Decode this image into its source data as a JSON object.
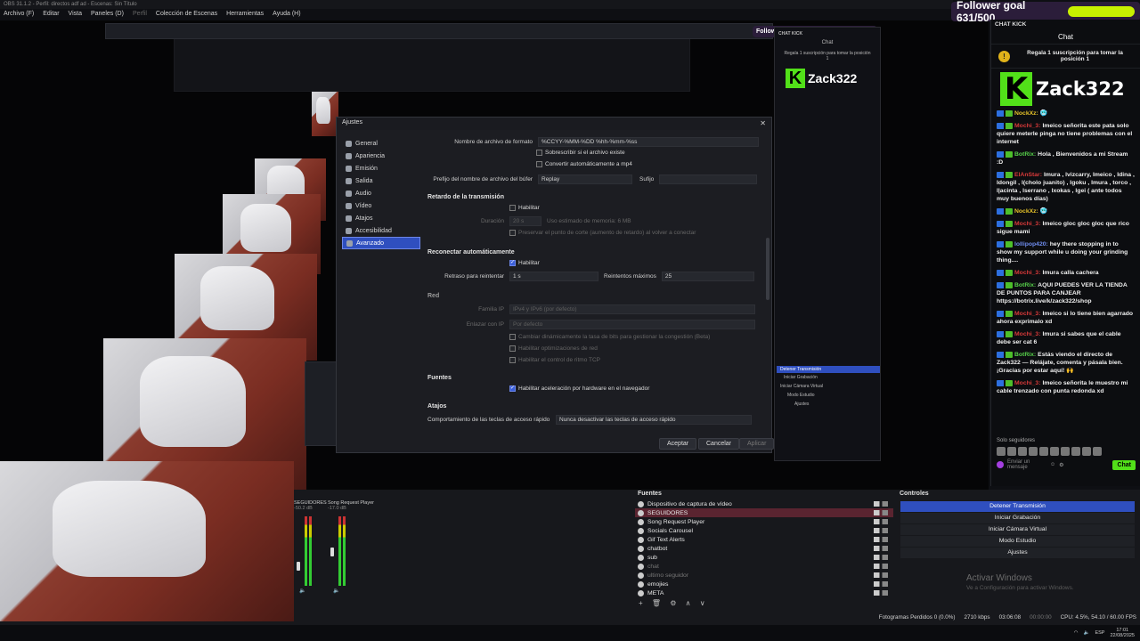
{
  "window": {
    "title": "OBS 31.1.2 - Perfil: directos adf ad - Escenas: Sin Título"
  },
  "menu": [
    "Archivo (F)",
    "Editar",
    "Vista",
    "Paneles (D)",
    "Perfil",
    "Colección de Escenas",
    "Herramientas",
    "Ayuda (H)"
  ],
  "follower_goal": {
    "label": "Follower goal 631/500",
    "progress": 1.0,
    "bar_color": "#c8f000"
  },
  "settings": {
    "title": "Ajustes",
    "nav": [
      {
        "label": "General",
        "icon": "gear-icon"
      },
      {
        "label": "Apariencia",
        "icon": "palette-icon"
      },
      {
        "label": "Emisión",
        "icon": "broadcast-icon"
      },
      {
        "label": "Salida",
        "icon": "output-icon"
      },
      {
        "label": "Audio",
        "icon": "speaker-icon"
      },
      {
        "label": "Vídeo",
        "icon": "monitor-icon"
      },
      {
        "label": "Atajos",
        "icon": "keyboard-icon"
      },
      {
        "label": "Accesibilidad",
        "icon": "accessibility-icon"
      },
      {
        "label": "Avanzado",
        "icon": "wrench-icon",
        "active": true
      }
    ],
    "format_name_label": "Nombre de archivo de formato",
    "format_name_value": "%CCYY-%MM-%DD %hh-%mm-%ss",
    "overwrite_label": "Sobrescribir si el archivo existe",
    "remux_label": "Convertir automáticamente a mp4",
    "buffer_prefix_label": "Prefijo del nombre de archivo del búfer",
    "buffer_prefix_value": "Replay",
    "suffix_label": "Sufijo",
    "delay_section": "Retardo de la transmisión",
    "delay_enable": "Habilitar",
    "duration_label": "Duración",
    "duration_value": "20 s",
    "memory_estimate": "Uso estimado de memoria: 6 MB",
    "preserve_cutoff": "Preservar el punto de corte (aumento de retardo) al volver a conectar",
    "reconnect_section": "Reconectar automáticamente",
    "reconnect_enable": "Habilitar",
    "retry_delay_label": "Retraso para reintentar",
    "retry_delay_value": "1 s",
    "max_retries_label": "Reintentos máximos",
    "max_retries_value": "25",
    "network_section": "Red",
    "ip_family_label": "Familia IP",
    "ip_family_value": "IPv4 y IPv6 (por defecto)",
    "bind_ip_label": "Enlazar con IP",
    "bind_ip_value": "Por defecto",
    "dynamic_bitrate": "Cambiar dinámicamente la tasa de bits para gestionar la congestión (Beta)",
    "network_opt": "Habilitar optimizaciones de red",
    "tcp_pacing": "Habilitar el control de ritmo TCP",
    "sources_section": "Fuentes",
    "hw_accel": "Habilitar aceleración por hardware en el navegador",
    "hotkeys_section": "Atajos",
    "hotkey_behavior_label": "Comportamiento de las teclas de acceso rápido",
    "hotkey_behavior_value": "Nunca desactivar las teclas de acceso rápido",
    "buttons": {
      "accept": "Aceptar",
      "cancel": "Cancelar",
      "apply": "Aplicar"
    }
  },
  "chat": {
    "header": "CHAT KICK",
    "title": "Chat",
    "pinned": "Regala 1 suscripción para tomar la posición 1",
    "channel": "Zack322",
    "messages": [
      {
        "user": "NockXz:",
        "text": "🥶",
        "color": "#e6c229"
      },
      {
        "user": "Mochi_3:",
        "text": "Imeico señorita este pata solo quiere meterle pinga no tiene problemas con el internet",
        "color": "#d93a3a"
      },
      {
        "user": "BotRix:",
        "text": "Hola , Bienvenidos a mi Stream :D",
        "color": "#57d14a"
      },
      {
        "user": "ElAnStar:",
        "text": "Imura , lvizcarry, Imeico , Idina , Idongil , l(cholo juanito) , Igoku , Imura , torco , l|acinta , lserrano , lxokas , lgei ( ante todos muy buenos días)",
        "color": "#d93a3a"
      },
      {
        "user": "NockXz:",
        "text": "🥶",
        "color": "#e6c229"
      },
      {
        "user": "Mochi_3:",
        "text": "Imeico gloc gloc gloc que rico sigue mami",
        "color": "#d93a3a"
      },
      {
        "user": "lollipop420:",
        "text": "hey there stopping in to show my support while u doing your grinding thing....",
        "color": "#6f8df0"
      },
      {
        "user": "Mochi_3:",
        "text": "Imura calla cachera",
        "color": "#d93a3a"
      },
      {
        "user": "BotRix:",
        "text": "AQUI PUEDES VER LA TIENDA DE PUNTOS PARA CANJEAR https://botrix.live/k/zack322/shop",
        "color": "#57d14a"
      },
      {
        "user": "Mochi_3:",
        "text": "Imeico si lo tiene bien agarrado ahora exprimalo xd",
        "color": "#d93a3a"
      },
      {
        "user": "Mochi_3:",
        "text": "Imura si sabes que el cable debe ser cat 6",
        "color": "#d93a3a"
      },
      {
        "user": "BotRix:",
        "text": "Estás viendo el directo de Zack322 — Relájate, comenta y pásala bien. ¡Gracias por estar aquí! 🙌",
        "color": "#57d14a"
      },
      {
        "user": "Mochi_3:",
        "text": "Imeico señorita le muestro mi cable trenzado con punta redonda xd",
        "color": "#d93a3a"
      }
    ],
    "followers_only": "Solo seguidores",
    "input_placeholder": "Enviar un mensaje",
    "send_label": "Chat"
  },
  "mixer": {
    "channels": [
      {
        "name": "SEGUIDORES",
        "db": "-50.2 dB",
        "level": 0.35
      },
      {
        "name": "Song Request Player",
        "db": "-17.0 dB",
        "level": 0.55
      }
    ]
  },
  "sources": {
    "title": "Fuentes",
    "items": [
      {
        "label": "Dispositivo de captura de vídeo"
      },
      {
        "label": "SEGUIDORES",
        "selected": true
      },
      {
        "label": "Song Request Player"
      },
      {
        "label": "Socials Carousel"
      },
      {
        "label": "Gif Text Alerts"
      },
      {
        "label": "chatbot"
      },
      {
        "label": "sub"
      },
      {
        "label": "chat",
        "dim": true
      },
      {
        "label": "ultimo seguidor",
        "dim": true
      },
      {
        "label": "emojies"
      },
      {
        "label": "META"
      }
    ],
    "tools": "+ 🗑 ⚙ ∧ ∨"
  },
  "controls": {
    "title": "Controles",
    "items": [
      {
        "label": "Detener Transmisión",
        "active": true
      },
      {
        "label": "Iniciar Grabación"
      },
      {
        "label": "Iniciar Cámara Virtual"
      },
      {
        "label": "Modo Estudio"
      },
      {
        "label": "Ajustes"
      }
    ]
  },
  "windows_activation": {
    "title": "Activar Windows",
    "subtitle": "Ve a Configuración para activar Windows."
  },
  "status": {
    "dropped": "Fotogramas Perdidos 0 (0.0%)",
    "bitrate": "2710 kbps",
    "stream_time": "03:06:08",
    "rec_time": "00:00:00",
    "cpu": "CPU: 4.5%, 54.10 / 60.00 FPS"
  },
  "taskbar": {
    "lang": "ESP",
    "time": "17:01",
    "date": "22/08/2025"
  }
}
